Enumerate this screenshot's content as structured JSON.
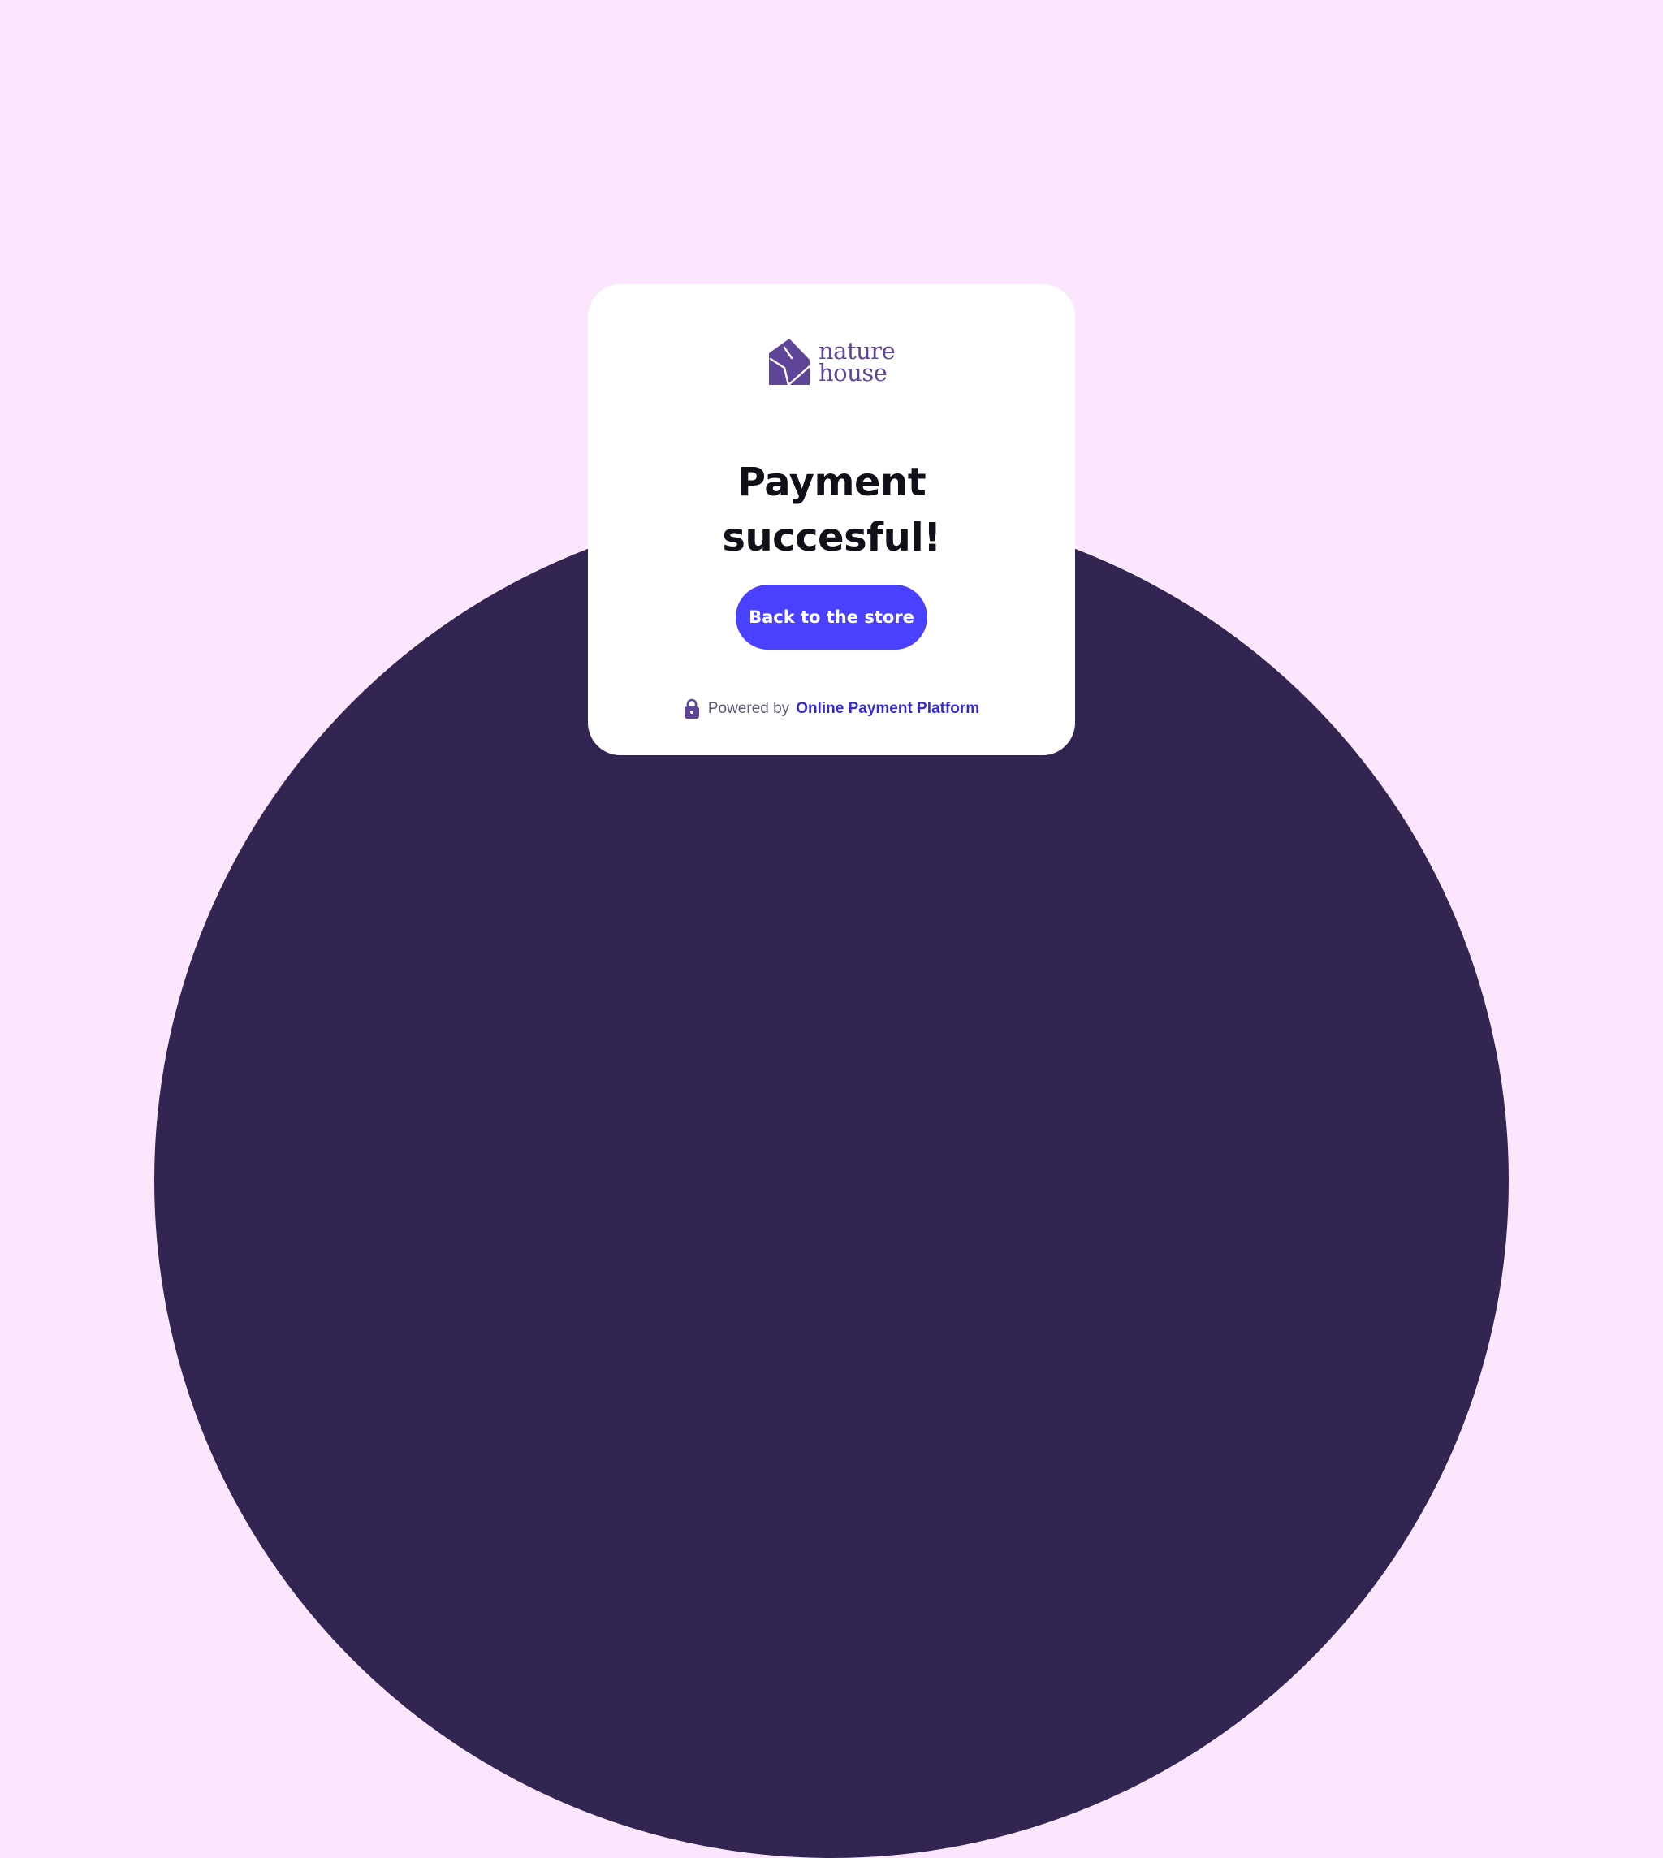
{
  "page": {
    "background_color": "#fce6fe",
    "circle_color": "#332552"
  },
  "card": {
    "logo": {
      "icon": "house-leaf-icon",
      "word_line1": "nature",
      "word_line2": "house",
      "color": "#5e4597"
    },
    "title_line1": "Payment",
    "title_line2": "succesful!",
    "button_label": "Back to the store",
    "button_color": "#4a40ff",
    "footer": {
      "icon": "lock-icon",
      "powered_by": "Powered by",
      "platform_name": "Online Payment Platform",
      "link_color": "#352bd6"
    }
  }
}
